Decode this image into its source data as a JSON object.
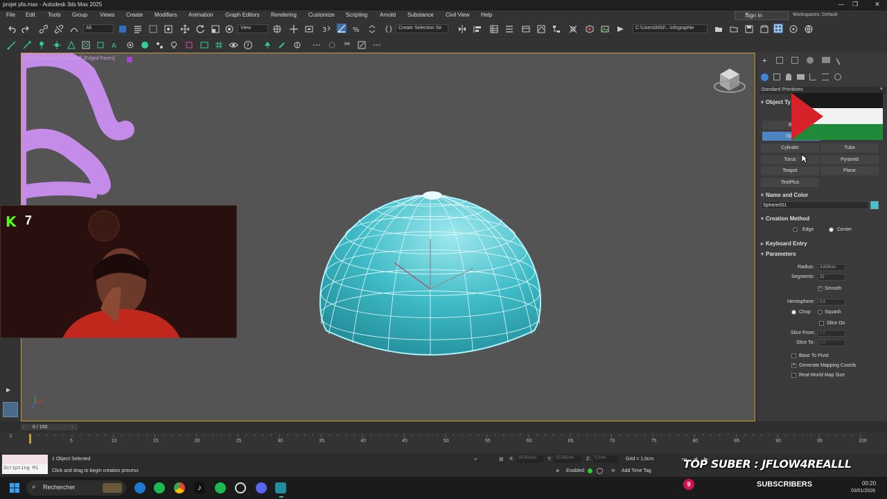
{
  "window": {
    "title": "projet pfa.max - Autodesk 3ds Max 2025",
    "minimize": "—",
    "maximize": "❐",
    "close": "✕"
  },
  "menu": [
    "File",
    "Edit",
    "Tools",
    "Group",
    "Views",
    "Create",
    "Modifiers",
    "Animation",
    "Graph Editors",
    "Rendering",
    "Customize",
    "Scripting",
    "Arnold",
    "Substance",
    "Civil View",
    "Help"
  ],
  "account": {
    "sign_in": "Sign In",
    "workspaces_label": "Workspaces:",
    "workspace_value": "Default"
  },
  "toolbar": {
    "filter_value": "All",
    "view_value": "View",
    "selection_set_placeholder": "Create Selection Se",
    "path_value": "C:\\Users\\MSI\\...\\nfographie"
  },
  "viewport": {
    "label": "[+] [Perspective] [Standard] [Edged Faces]"
  },
  "command_panel": {
    "category_dropdown": "Standard Primitives",
    "object_type_header": "Object Ty",
    "primitives": {
      "box": "Bo",
      "sphere": "Sphe",
      "cylinder": "Cylinder",
      "tube": "Tube",
      "torus": "Torus",
      "pyramid": "Pyramid",
      "teapot": "Teapot",
      "plane": "Plane",
      "textplus": "TextPlus"
    },
    "name_and_color_header": "Name and Color",
    "object_name": "Sphere001",
    "object_color": "#40c4d0",
    "creation_method_header": "Creation Method",
    "creation_methods": [
      "Edge",
      "Center"
    ],
    "creation_method_selected": "Center",
    "keyboard_entry_header": "Keyboard Entry",
    "parameters_header": "Parameters",
    "params": {
      "radius_label": "Radius:",
      "radius_value": "4,658cm",
      "segments_label": "Segments:",
      "segments_value": "32",
      "smooth_label": "Smooth",
      "hemisphere_label": "Hemisphere:",
      "hemisphere_value": "0,5",
      "chop_label": "Chop",
      "squash_label": "Squash",
      "slice_on_label": "Slice On",
      "slice_from_label": "Slice From:",
      "slice_from_value": "0,0",
      "slice_to_label": "Slice To:",
      "slice_to_value": "0,0",
      "base_to_pivot_label": "Base To Pivot",
      "gen_mapping_label": "Generate Mapping Coords",
      "real_world_label": "Real-World Map Size"
    }
  },
  "timeline": {
    "frame_display": "0 / 100",
    "ticks": [
      "5",
      "10",
      "15",
      "20",
      "25",
      "30",
      "35",
      "40",
      "45",
      "50",
      "55",
      "60",
      "65",
      "70",
      "75",
      "80",
      "85",
      "90",
      "95",
      "100"
    ]
  },
  "status": {
    "script_label": "Scripting Mi",
    "selected": "1 Object Selected",
    "prompt": "Click and drag to begin creation process",
    "x_label": "X:",
    "x_value": "39,802cm",
    "y_label": "Y:",
    "y_value": "10,862cm",
    "z_label": "Z:",
    "z_value": "0,0cm",
    "grid": "Grid = 1,0cm",
    "enabled_label": "Enabled:",
    "add_time_tag": "Add Time Tag"
  },
  "overlay": {
    "webcam_counter": "7",
    "banner": "TOP SUBER : JFLOW4REALLL",
    "subscribers_count": "9",
    "subscribers_label": "SUBSCRIBERS"
  },
  "taskbar": {
    "search_placeholder": "Rechercher",
    "time": "00:20",
    "date": "03/01/2026"
  }
}
